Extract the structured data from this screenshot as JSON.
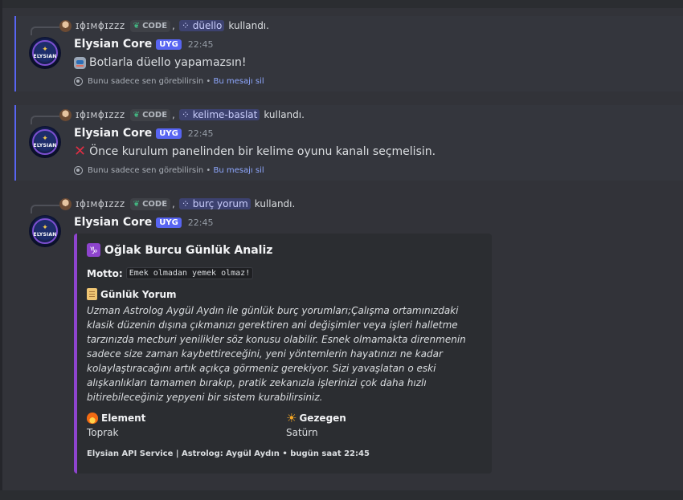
{
  "messages": [
    {
      "reply": {
        "user": "ɪɸɪᴍɸɪzzz",
        "tag": "CODE",
        "command": "düello",
        "used": "kullandı."
      },
      "author": "Elysian Core",
      "app_tag": "UYG",
      "time": "22:45",
      "content": "Botlarla düello yapamazsın!",
      "icon": "robot-emoji",
      "note": {
        "text": "Bunu sadece sen görebilirsin",
        "sep": "•",
        "delete": "Bu mesajı sil"
      }
    },
    {
      "reply": {
        "user": "ɪɸɪᴍɸɪzzz",
        "tag": "CODE",
        "command": "kelime-baslat",
        "used": "kullandı."
      },
      "author": "Elysian Core",
      "app_tag": "UYG",
      "time": "22:45",
      "content": "Önce kurulum panelinden bir kelime oyunu kanalı seçmelisin.",
      "icon": "cross-mark-emoji",
      "note": {
        "text": "Bunu sadece sen görebilirsin",
        "sep": "•",
        "delete": "Bu mesajı sil"
      }
    },
    {
      "reply": {
        "user": "ɪɸɪᴍɸɪzzz",
        "tag": "CODE",
        "command": "burç yorum",
        "used": "kullandı."
      },
      "author": "Elysian Core",
      "app_tag": "UYG",
      "time": "22:45",
      "embed": {
        "title": "Oğlak Burcu Günlük Analiz",
        "title_icon": "♑",
        "motto_label": "Motto:",
        "motto": "Emek olmadan yemek olmaz!",
        "yorum_label": "Günlük Yorum",
        "yorum": "Uzman Astrolog Aygül Aydın ile günlük burç yorumları;Çalışma ortamınızdaki klasik düzenin dışına çıkmanızı gerektiren ani değişimler veya işleri halletme tarzınızda mecburi yenilikler söz konusu olabilir. Esnek olmamakta direnmenin sadece size zaman kaybettireceğini, yeni yöntemlerin hayatınızı ne kadar kolaylaştıracağını artık açıkça görmeniz gerekiyor. Sizi yavaşlatan o eski alışkanlıkları tamamen bırakıp, pratik zekanızla işlerinizi çok daha hızlı bitirebileceğiniz yepyeni bir sistem kurabilirsiniz.",
        "element_label": "Element",
        "element_value": "Toprak",
        "planet_label": "Gezegen",
        "planet_value": "Satürn",
        "footer": "Elysian API Service | Astrolog: Aygül Aydın • bugün saat 22:45",
        "accent": "#8e44ce"
      }
    }
  ],
  "avatar_text": "ELYSIAN",
  "colors": {
    "background": "#323339",
    "ephemeral_bg": "#34363d",
    "blurple": "#5865f2",
    "link": "#8fa8ff"
  }
}
